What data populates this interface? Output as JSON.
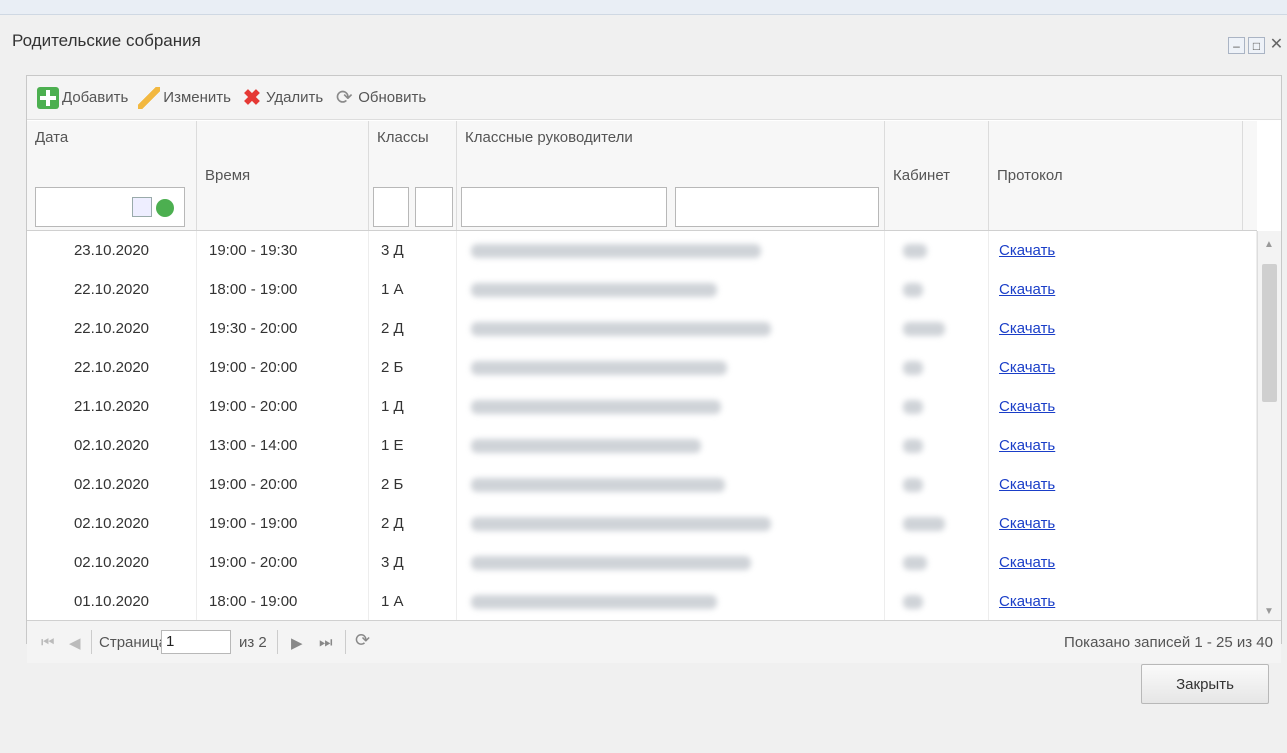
{
  "window": {
    "title": "Родительские собрания"
  },
  "toolbar": {
    "add": "Добавить",
    "edit": "Изменить",
    "delete": "Удалить",
    "refresh": "Обновить"
  },
  "columns": {
    "date": "Дата",
    "time": "Время",
    "classes": "Классы",
    "teachers": "Классные руководители",
    "room": "Кабинет",
    "protocol": "Протокол"
  },
  "rows": [
    {
      "date": "23.10.2020",
      "time": "19:00 - 19:30",
      "class": "3 Д",
      "link": "Скачать"
    },
    {
      "date": "22.10.2020",
      "time": "18:00 - 19:00",
      "class": "1 А",
      "link": "Скачать"
    },
    {
      "date": "22.10.2020",
      "time": "19:30 - 20:00",
      "class": "2 Д",
      "link": "Скачать"
    },
    {
      "date": "22.10.2020",
      "time": "19:00 - 20:00",
      "class": "2 Б",
      "link": "Скачать"
    },
    {
      "date": "21.10.2020",
      "time": "19:00 - 20:00",
      "class": "1 Д",
      "link": "Скачать"
    },
    {
      "date": "02.10.2020",
      "time": "13:00 - 14:00",
      "class": "1 Е",
      "link": "Скачать"
    },
    {
      "date": "02.10.2020",
      "time": "19:00 - 20:00",
      "class": "2 Б",
      "link": "Скачать"
    },
    {
      "date": "02.10.2020",
      "time": "19:00 - 19:00",
      "class": "2 Д",
      "link": "Скачать"
    },
    {
      "date": "02.10.2020",
      "time": "19:00 - 20:00",
      "class": "3 Д",
      "link": "Скачать"
    },
    {
      "date": "01.10.2020",
      "time": "18:00 - 19:00",
      "class": "1 А",
      "link": "Скачать"
    }
  ],
  "pager": {
    "page_label": "Страница",
    "page_value": "1",
    "of_label": "из 2",
    "summary": "Показано записей 1 - 25 из 40"
  },
  "close_label": "Закрыть"
}
